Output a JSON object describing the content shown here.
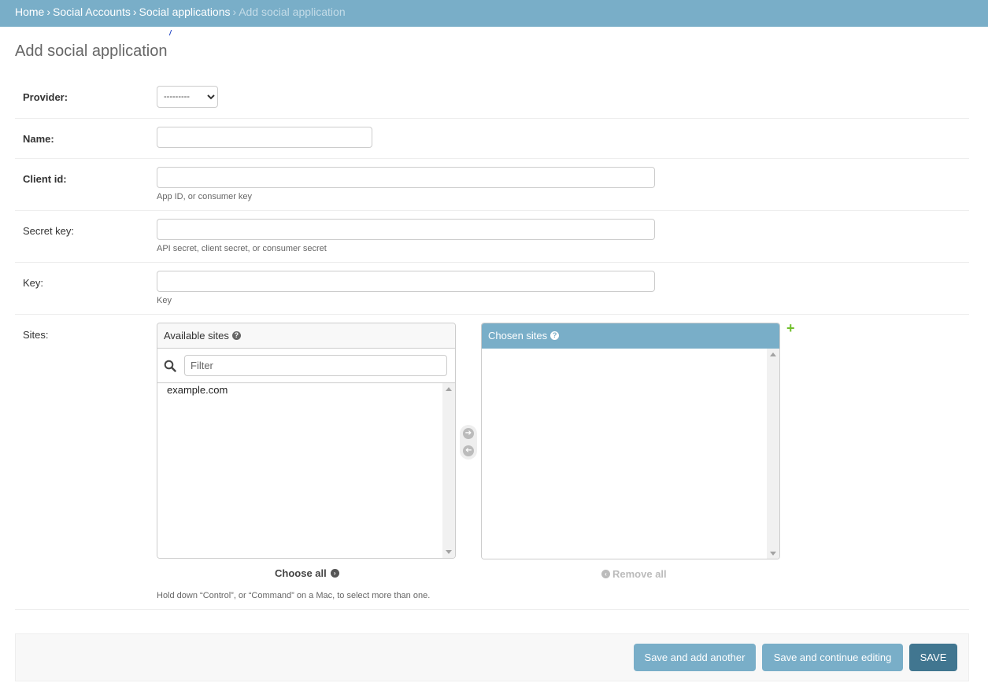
{
  "breadcrumbs": {
    "items": [
      "Home",
      "Social Accounts",
      "Social applications"
    ],
    "current": "Add social application",
    "separator": "›"
  },
  "page_title": "Add social application",
  "form": {
    "provider": {
      "label": "Provider:",
      "selected": "---------"
    },
    "name": {
      "label": "Name:",
      "value": ""
    },
    "client_id": {
      "label": "Client id:",
      "value": "",
      "help": "App ID, or consumer key"
    },
    "secret_key": {
      "label": "Secret key:",
      "value": "",
      "help": "API secret, client secret, or consumer secret"
    },
    "key": {
      "label": "Key:",
      "value": "",
      "help": "Key"
    },
    "sites": {
      "label": "Sites:",
      "available_title": "Available sites",
      "chosen_title": "Chosen sites",
      "filter_placeholder": "Filter",
      "available": [
        "example.com"
      ],
      "chosen": [],
      "choose_all": "Choose all",
      "remove_all": "Remove all",
      "help": "Hold down “Control”, or “Command” on a Mac, to select more than one."
    }
  },
  "buttons": {
    "save_add_another": "Save and add another",
    "save_continue": "Save and continue editing",
    "save": "SAVE"
  },
  "colors": {
    "header": "#79aec8",
    "primary_button": "#417690",
    "add_icon": "#70bf2b"
  }
}
